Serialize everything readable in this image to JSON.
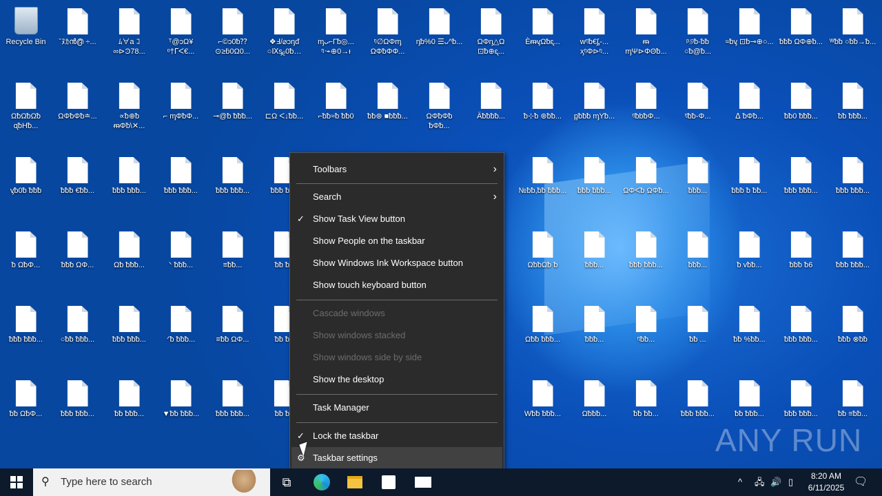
{
  "desktop": {
    "recycle_bin": "Recycle Bin",
    "icons": [
      [
        "ˇﾇｶൻ൫ ÷...",
        "ﾑ∀a ｺ∞⊳Ͽ78...",
        "ᵀ@ↄΩ¥ ᵒ†ᒥᐸ€...",
        "⌐©ↄ0ᵬ⁇ ⊙≥ḃ0Ω0...",
        "❖Ⅎ/⌀ↄᶇᵭ ○Ⅸᶊᵨ0ᵬ…",
        "ᶆᴗ⌐Γᵬ◎... ᵑᐧ⌁⊕0→ᵼ",
        "ᵑ∅ΩΦᶆ ΩΦᵬΦΦ...",
        "ᶇᵬ%0 ☰ᴗ^ᵬ...",
        "ΩΦᶇ△Ω ⊡ᵬ⊕ᶓ...",
        "ÈᵯᶌΩᵬᶓ...",
        "wᵑᵬ€ᶋ-... ᶍᵑΦ⊳ᵑ...",
        "ᵯ ᶆΨ⊳ΦΘᵬ...",
        "ᵖ୬ᵬ-ᵬᵬ ○ᵬ@ᵬ...",
        "≈ᵬᶌ ⊡ᵬ⊸⊕○...",
        "ᵬᵬᵬ ΩΦ⊕ᵬ...",
        "ᵂᵬᵬ ○ᵬᵬ→ᵬ..."
      ],
      [
        "ΩᵬΩᵬΩᵬ ᶐᵬΗᵬ...",
        "ΩΦᵬΦᵬ≐...",
        "∝ᵬ⊕ᵬ ᵯΦᵬ\\✕...",
        "⌐ ᶆΦᵬΦ...",
        "⊸@ᵬ ᵬᵬᵬ...",
        "⊏Ω ᐸ↓ᵬᵬ...",
        "⌐ᵬᵬ≈ᵬ ᵬᵬ0",
        "ᵬᵬ⊛ ■ᵬᵬᵬ...",
        "ΩΦᵬΦᵬ ᵬΦᵬ...",
        "Äᵬᵬᵬᵬ...",
        "ᵬ⊹ᵬ ⊛ᵬᵬ...",
        "ᶈᵬᵬᵬ ᶆΥᵬ...",
        "ᵑᵬbᵬΦ...",
        "ᵑᵬᵬ-Φ...",
        "ᐃ ᵬΦᵬ...",
        "ᵬᵬ0 ᵬᵬᵬ...",
        "ᵬᵬ ᵬᵬᵬ..."
      ],
      [
        "ᶌᵬ0ᵬ ᵬᵬᵬ",
        "ᵬᵬᵬ €ᵬᵬ...",
        "ᵬᵬᵬ ᵬᵬᵬ...",
        "ᵬᵬᵬ ᵬᵬᵬ...",
        "ᵬᵬᵬ ᵬᵬᵬ...",
        "ᵬᵬᵬ ᵬᵬᵬ",
        "",
        "",
        "",
        "",
        "№ᵬᵬ,ᵬᵬ ᵬᵬᵬ...",
        "ᵬᵬᵬ ᵬᵬᵬ...",
        "ΩΦᐸᵬ ΩΦᵬ...",
        "ᵬᵬᵬ...",
        "ᵬᵬᵬ ᵬ ᵬᵬ...",
        "ᵬᵬᵬ ᵬᵬᵬ...",
        "ᵬᵬᵬ ᵬᵬᵬ..."
      ],
      [
        "ᵬ ΩᵬΦ...",
        "ᵬᵬᵬ ΩΦ...",
        "Ωᵬ ᵬᵬᵬ...",
        "ᐠ ᵬᵬᵬ...",
        "≡ᵬᵬ...",
        "ᵬᵬ ᵬᵬ",
        "",
        "",
        "",
        "",
        "ΩᵬᵬΩᵬ ᵬ",
        "ᵬᵬᵬ...",
        "ᵬᵬᵬ ᵬᵬᵬ...",
        "ᵬᵬᵬ...",
        "ᵬ vᵬᵬ...",
        "ᵬᵬᵬ ᵬ6",
        "ᵬᵬᵬ ᵬᵬᵬ..."
      ],
      [
        "ᵬᵬᵬ ᵬᵬᵬ...",
        "○ᵬᵬ ᵬᵬᵬ...",
        "ᵬᵬᵬ ᵬᵬᵬ...",
        "ᐟᵬ ᵬᵬᵬ...",
        "≡ᵬᵬ ΩΦ...",
        "ᵬᵬ ᵬᵬ",
        "",
        "",
        "",
        "",
        "Ωᵬᵬ ᵬᵬᵬ...",
        "ᵬᵬᵬ...",
        "ᵑᵬᵬ...",
        "ᵬᵬ ...",
        "ᵬᵬ %ᵬᵬ...",
        "ᵬᵬᵬ ᵬᵬᵬ...",
        "ᵬᵬᵬ ⊗ᵬᵬ"
      ],
      [
        "ᵬᵬ ΩᵬΦ...",
        "ᵬᵬᵬ ᵬᵬᵬ...",
        "ᵬᵬ ᵬᵬᵬ...",
        "▼ᵬᵬ ᵬᵬᵬ...",
        "ᵬᵬᵬ ᵬᵬᵬ...",
        "ᵬᵬ ᵬᵬ",
        "",
        "",
        "",
        "",
        "Wᵬᵬ ᵬᵬᵬ...",
        "Ωᵬᵬᵬ...",
        "ᵬᵬ ᵬᵬ...",
        "ᵬᵬᵬ ᵬᵬᵬ...",
        "ᵬᵬ ᵬᵬᵬ...",
        "ᵬᵬᵬ ᵬᵬᵬ...",
        "ᵬᵬ ≡ᵬᵬ..."
      ]
    ]
  },
  "context_menu": {
    "toolbars": "Toolbars",
    "search": "Search",
    "task_view": "Show Task View button",
    "people": "Show People on the taskbar",
    "ink": "Show Windows Ink Workspace button",
    "touch_kb": "Show touch keyboard button",
    "cascade": "Cascade windows",
    "stacked": "Show windows stacked",
    "side_by_side": "Show windows side by side",
    "show_desktop": "Show the desktop",
    "task_manager": "Task Manager",
    "lock": "Lock the taskbar",
    "settings": "Taskbar settings"
  },
  "taskbar": {
    "search_placeholder": "Type here to search",
    "time": "8:20 AM",
    "date": "6/11/2025"
  },
  "watermark": "ANY RUN"
}
